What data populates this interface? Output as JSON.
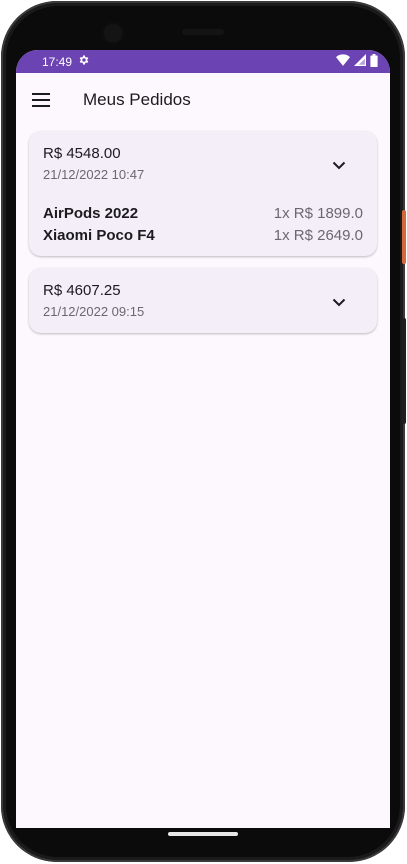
{
  "status_bar": {
    "time": "17:49",
    "icons": [
      "settings-icon",
      "wifi-icon",
      "signal-icon",
      "battery-icon"
    ]
  },
  "app_bar": {
    "title": "Meus Pedidos",
    "menu_icon": "hamburger-menu-icon"
  },
  "orders": [
    {
      "total": "R$ 4548.00",
      "date": "21/12/2022 10:47",
      "expanded": true,
      "items": [
        {
          "name": "AirPods 2022",
          "qty_price": "1x R$ 1899.0"
        },
        {
          "name": "Xiaomi Poco F4",
          "qty_price": "1x R$ 2649.0"
        }
      ]
    },
    {
      "total": "R$ 4607.25",
      "date": "21/12/2022 09:15",
      "expanded": false,
      "items": []
    }
  ],
  "colors": {
    "status_bar": "#6c43b3",
    "background": "#fdf8fd",
    "card": "#f3eef8"
  }
}
